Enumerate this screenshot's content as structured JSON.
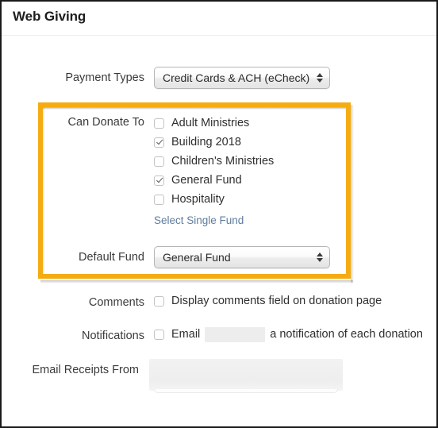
{
  "panel": {
    "title": "Web Giving"
  },
  "colors": {
    "highlight_border": "#f5ac13",
    "link": "#5f7d9e",
    "label_text": "#3a3a3c",
    "body_text": "#2f2f31",
    "page_border": "#1a1a1a"
  },
  "fields": {
    "payment_types": {
      "label": "Payment Types",
      "value": "Credit Cards & ACH (eCheck)",
      "control": "select"
    },
    "can_donate_to": {
      "label": "Can Donate To",
      "control": "checkbox-list",
      "options": [
        {
          "label": "Adult Ministries",
          "checked": false
        },
        {
          "label": "Building 2018",
          "checked": true
        },
        {
          "label": "Children's Ministries",
          "checked": false
        },
        {
          "label": "General Fund",
          "checked": true
        },
        {
          "label": "Hospitality",
          "checked": false
        }
      ],
      "link": "Select Single Fund"
    },
    "default_fund": {
      "label": "Default Fund",
      "value": "General Fund",
      "control": "select"
    },
    "comments": {
      "label": "Comments",
      "checkbox_label": "Display comments field on donation page",
      "checked": false
    },
    "notifications": {
      "label": "Notifications",
      "checked": false,
      "text_before": "Email",
      "value": "",
      "text_after": "a notification of each donation"
    },
    "email_receipts_from": {
      "label": "Email Receipts From",
      "value": ""
    }
  }
}
